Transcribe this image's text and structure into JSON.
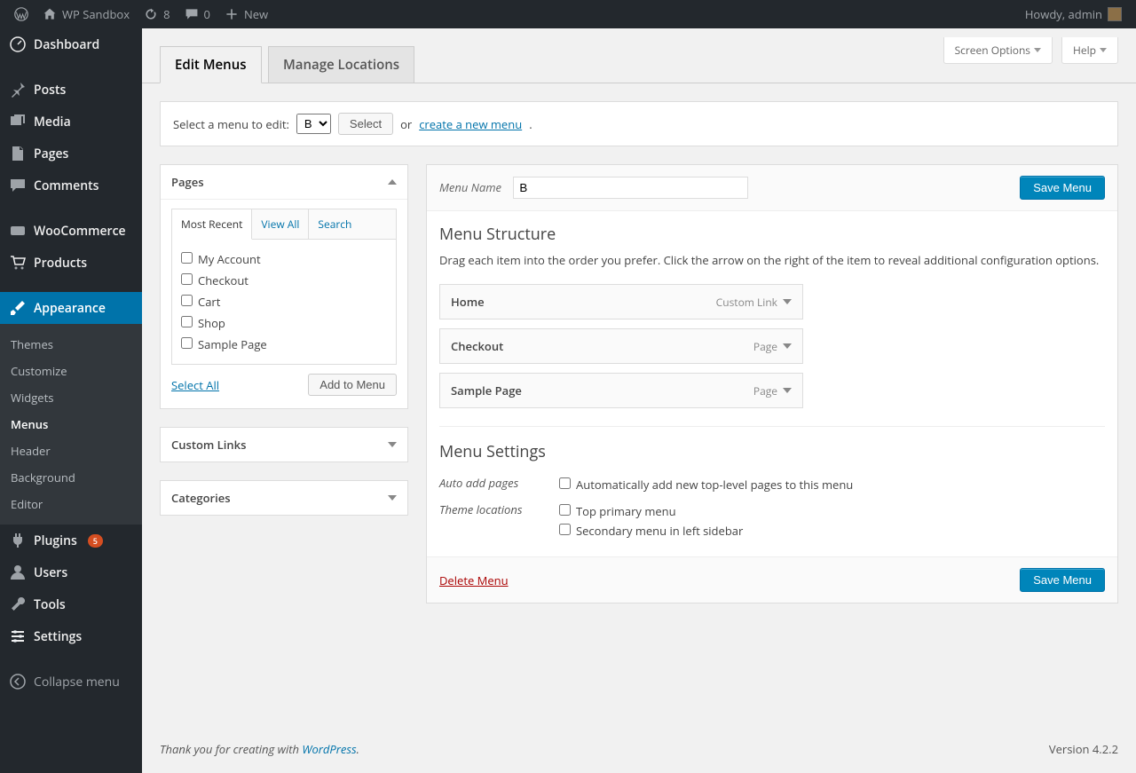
{
  "adminbar": {
    "site_name": "WP Sandbox",
    "updates": "8",
    "comments": "0",
    "new": "New",
    "howdy": "Howdy, admin"
  },
  "sidebar": {
    "dashboard": "Dashboard",
    "posts": "Posts",
    "media": "Media",
    "pages": "Pages",
    "comments": "Comments",
    "woocommerce": "WooCommerce",
    "products": "Products",
    "appearance": "Appearance",
    "appearance_sub": {
      "themes": "Themes",
      "customize": "Customize",
      "widgets": "Widgets",
      "menus": "Menus",
      "header": "Header",
      "background": "Background",
      "editor": "Editor"
    },
    "plugins": "Plugins",
    "plugins_count": "5",
    "users": "Users",
    "tools": "Tools",
    "settings": "Settings",
    "collapse": "Collapse menu"
  },
  "top": {
    "screen_options": "Screen Options",
    "help": "Help"
  },
  "tabs": {
    "edit": "Edit Menus",
    "locations": "Manage Locations"
  },
  "selectrow": {
    "label": "Select a menu to edit:",
    "selected": "B",
    "select_btn": "Select",
    "or": "or",
    "create": "create a new menu"
  },
  "pages_box": {
    "title": "Pages",
    "tab_recent": "Most Recent",
    "tab_viewall": "View All",
    "tab_search": "Search",
    "items": [
      "My Account",
      "Checkout",
      "Cart",
      "Shop",
      "Sample Page"
    ],
    "select_all": "Select All",
    "add": "Add to Menu"
  },
  "links_box": {
    "title": "Custom Links"
  },
  "cats_box": {
    "title": "Categories"
  },
  "menu": {
    "name_label": "Menu Name",
    "name_value": "B",
    "save": "Save Menu",
    "structure_h": "Menu Structure",
    "structure_p": "Drag each item into the order you prefer. Click the arrow on the right of the item to reveal additional configuration options.",
    "items": [
      {
        "title": "Home",
        "type": "Custom Link"
      },
      {
        "title": "Checkout",
        "type": "Page"
      },
      {
        "title": "Sample Page",
        "type": "Page"
      }
    ],
    "settings_h": "Menu Settings",
    "auto_add_label": "Auto add pages",
    "auto_add_opt": "Automatically add new top-level pages to this menu",
    "locations_label": "Theme locations",
    "loc1": "Top primary menu",
    "loc2": "Secondary menu in left sidebar",
    "delete": "Delete Menu"
  },
  "footer": {
    "thanks_pre": "Thank you for creating with ",
    "wp": "WordPress",
    "version": "Version 4.2.2"
  }
}
